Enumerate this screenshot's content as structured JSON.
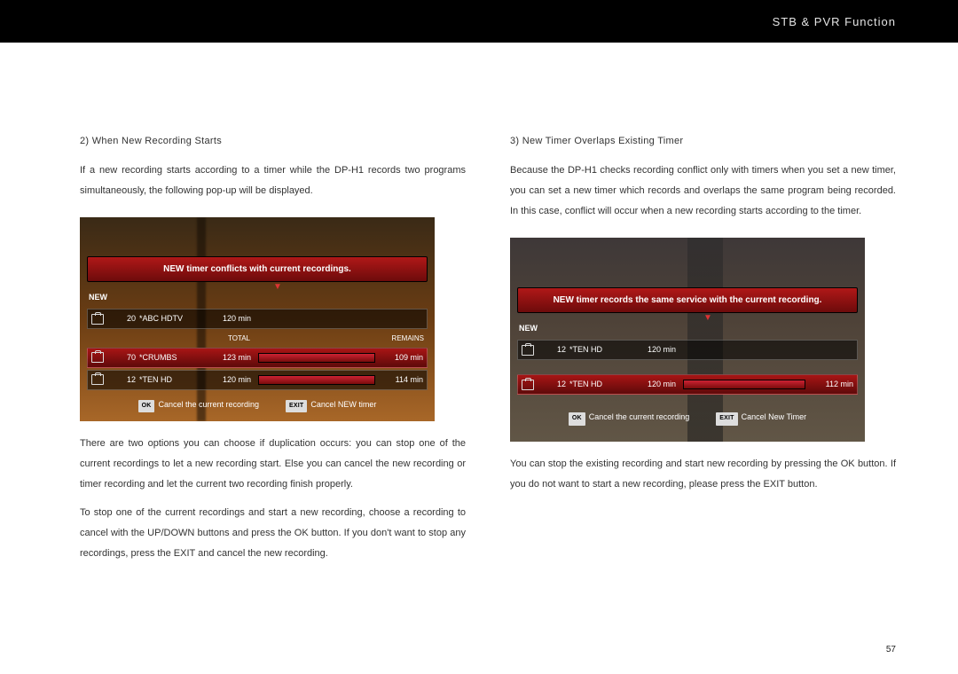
{
  "header": {
    "title": "STB & PVR Function"
  },
  "page_number": "57",
  "left": {
    "heading": "2) When New Recording Starts",
    "p1": "If a new recording starts according to a timer while the DP-H1 records two programs simultaneously, the following pop-up will be displayed.",
    "p2": "There are two options you can choose if duplication occurs: you can stop one of the current recordings to let a new recording start. Else you can cancel the new recording or timer recording and let the current two recording finish properly.",
    "p3": "To stop one of the current recordings and start a new recording, choose a recording to cancel with the UP/DOWN buttons and press the OK button. If you don't want to stop any recordings, press the EXIT and cancel the new recording.",
    "ui": {
      "banner": "NEW timer conflicts with current recordings.",
      "new_label": "NEW",
      "new_row": {
        "ch": "20",
        "name": "*ABC HDTV",
        "dur": "120 min"
      },
      "col_total": "TOTAL",
      "col_remains": "REMAINS",
      "rows": [
        {
          "ch": "70",
          "name": "*CRUMBS",
          "dur": "123 min",
          "rem": "109 min",
          "sel": true
        },
        {
          "ch": "12",
          "name": "*TEN HD",
          "dur": "120 min",
          "rem": "114 min",
          "sel": false
        }
      ],
      "btn_ok": "OK",
      "ok_text": "Cancel the current recording",
      "btn_exit": "EXIT",
      "exit_text": "Cancel NEW timer"
    }
  },
  "right": {
    "heading": "3) New Timer Overlaps Existing Timer",
    "p1": "Because the DP-H1 checks recording conflict only with timers when you set a new timer, you can set a new timer which records and overlaps the same program being recorded. In this case, conflict will occur when a new recording starts according to the timer.",
    "p2": "You can stop the existing recording and start new recording by pressing the OK button. If you do not want to start a new recording, please press the EXIT button.",
    "ui": {
      "banner": "NEW timer records the same service with the current recording.",
      "new_label": "NEW",
      "new_row": {
        "ch": "12",
        "name": "*TEN HD",
        "dur": "120 min"
      },
      "row": {
        "ch": "12",
        "name": "*TEN HD",
        "dur": "120 min",
        "rem": "112 min"
      },
      "btn_ok": "OK",
      "ok_text": "Cancel the current recording",
      "btn_exit": "EXIT",
      "exit_text": "Cancel New Timer"
    }
  }
}
